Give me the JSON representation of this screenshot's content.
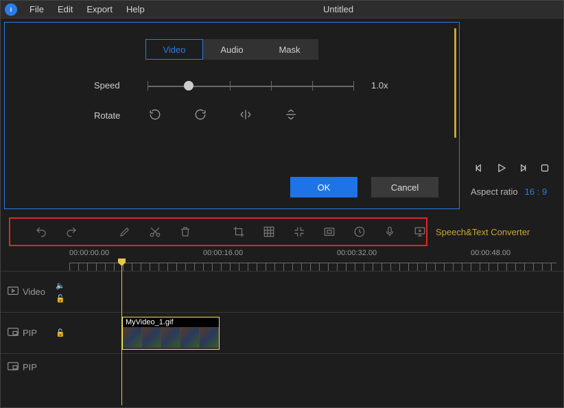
{
  "menu": {
    "file": "File",
    "edit": "Edit",
    "export": "Export",
    "help": "Help"
  },
  "title": "Untitled",
  "tabs": {
    "video": "Video",
    "audio": "Audio",
    "mask": "Mask"
  },
  "speed": {
    "label": "Speed",
    "value": "1.0x",
    "thumbPct": 20
  },
  "rotate": {
    "label": "Rotate"
  },
  "buttons": {
    "ok": "OK",
    "cancel": "Cancel"
  },
  "aspect": {
    "label": "Aspect ratio",
    "value": "16 : 9"
  },
  "speechText": "Speech&Text Converter",
  "timecodes": [
    "00:00:00.00",
    "00:00:16.00",
    "00:00:32.00",
    "00:00:48.00"
  ],
  "tracks": {
    "video": "Video",
    "pip1": "PIP",
    "pip2": "PIP"
  },
  "clip": {
    "name": "MyVideo_1.gif"
  }
}
